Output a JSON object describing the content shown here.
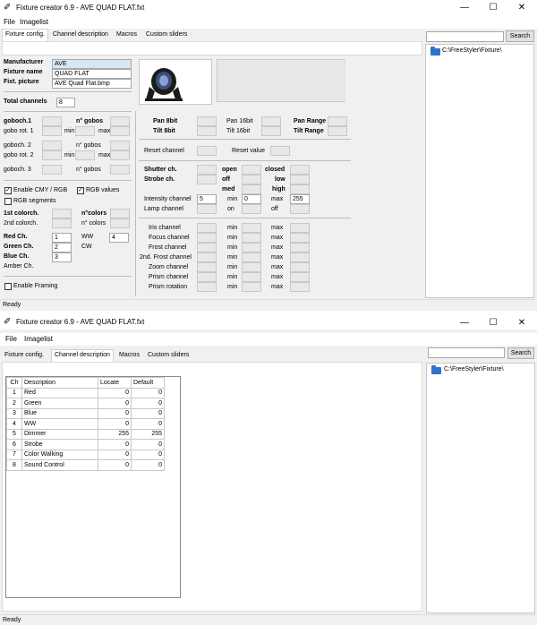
{
  "window1": {
    "title": "Fixture creator 6.9 - AVE QUAD FLAT.fxt",
    "controls": {
      "minimize": "—",
      "maximize": "☐",
      "close": "✕"
    },
    "menu": [
      "File",
      "Imagelist"
    ],
    "tabs": [
      "Fixture config.",
      "Channel description",
      "Macros",
      "Custom sliders"
    ],
    "search_button": "Search",
    "tree_path": "C:\\FreeStyler\\Fixture\\",
    "status": "Ready",
    "fixture": {
      "manufacturer_label": "Manufacturer",
      "manufacturer_value": "AVE",
      "name_label": "Fixture name",
      "name_value": "QUAD FLAT",
      "picture_label": "Fixt. picture",
      "picture_value": "AVE Quad Flat.bmp",
      "total_channels_label": "Total channels",
      "total_channels_value": "8"
    },
    "gobo": {
      "goboch1": "goboch.1",
      "ngobos": "n° gobos",
      "gobo_rot1": "gobo rot. 1",
      "min": "min",
      "max": "max",
      "goboch2": "goboch. 2",
      "ngobos2": "n° gobos",
      "gobo_rot2": "gobo rot. 2",
      "goboch3": "goboch. 3",
      "ngobos3": "n° gobos"
    },
    "color": {
      "enable_cmy": "Enable CMY / RGB",
      "rgb_values": "RGB values",
      "rgb_segments": "RGB segments",
      "colorch1": "1st colorch.",
      "ncolors": "n°colors",
      "colorch2": "2nd colorch.",
      "ncolors2": "n° colors",
      "red": "Red Ch.",
      "red_value": "1",
      "green": "Green Ch.",
      "green_value": "2",
      "blue": "Blue Ch.",
      "blue_value": "3",
      "amber": "Amber Ch.",
      "ww": "WW",
      "ww_value": "4",
      "cw": "CW",
      "enable_framing": "Enable Framing"
    },
    "pan": {
      "pan8": "Pan 8bit",
      "tilt8": "Tilt 8bit",
      "pan16": "Pan 16bit",
      "tilt16": "Tilt 16bit",
      "panrange": "Pan Range",
      "tiltrange": "Tilt Range",
      "reset_channel": "Reset channel",
      "reset_value": "Reset value"
    },
    "shutter": {
      "shutter": "Shutter ch.",
      "strobe": "Strobe ch.",
      "open": "open",
      "off": "off",
      "med": "med",
      "closed": "closed",
      "low": "low",
      "high": "high",
      "intensity": "Intensity channel",
      "intensity_value": "5",
      "min": "min",
      "min_value": "0",
      "max": "max",
      "max_value": "255",
      "lamp": "Lamp channel",
      "on": "on",
      "off2": "off"
    },
    "effects": [
      {
        "label": "Iris channel",
        "min": "min",
        "max": "max"
      },
      {
        "label": "Focus channel",
        "min": "min",
        "max": "max"
      },
      {
        "label": "Frost channel",
        "min": "min",
        "max": "max"
      },
      {
        "label": "2nd. Frost channel",
        "min": "min",
        "max": "max"
      },
      {
        "label": "Zoom channel",
        "min": "min",
        "max": "max"
      },
      {
        "label": "Prism channel",
        "min": "min",
        "max": "max"
      },
      {
        "label": "Prism rotation",
        "min": "min",
        "max": "max"
      }
    ]
  },
  "window2": {
    "title": "Fixture creator 6.9 - AVE QUAD FLAT.fxt",
    "controls": {
      "minimize": "—",
      "maximize": "☐",
      "close": "✕"
    },
    "menu": [
      "File",
      "Imagelist"
    ],
    "tabs": [
      "Fixture config.",
      "Channel description",
      "Macros",
      "Custom sliders"
    ],
    "search_button": "Search",
    "tree_path": "C:\\FreeStyler\\Fixture\\",
    "status": "Ready",
    "table": {
      "headers": [
        "Ch",
        "Description",
        "Locate",
        "Default"
      ],
      "rows": [
        [
          "1",
          "Red",
          "0",
          "0"
        ],
        [
          "2",
          "Green",
          "0",
          "0"
        ],
        [
          "3",
          "Blue",
          "0",
          "0"
        ],
        [
          "4",
          "WW",
          "0",
          "0"
        ],
        [
          "5",
          "Dimmer",
          "255",
          "255"
        ],
        [
          "6",
          "Strobe",
          "0",
          "0"
        ],
        [
          "7",
          "Color Walking",
          "0",
          "0"
        ],
        [
          "8",
          "Sound Control",
          "0",
          "0"
        ]
      ]
    }
  },
  "colors": {
    "folder": "#2e73c9",
    "chrome": "#f0f0f0"
  }
}
